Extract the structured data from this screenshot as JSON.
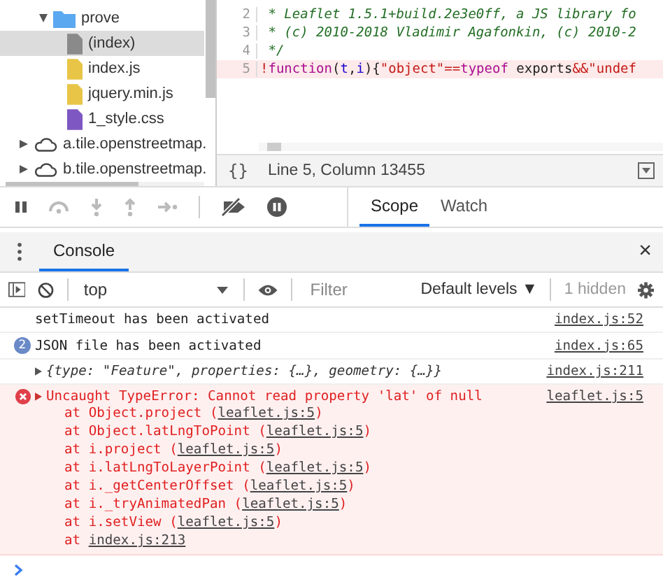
{
  "file_tree": [
    {
      "label": "prove",
      "kind": "folder",
      "expanded": true,
      "selected": false,
      "children": [
        {
          "label": "(index)",
          "kind": "document",
          "selected": true
        },
        {
          "label": "index.js",
          "kind": "script",
          "selected": false
        },
        {
          "label": "jquery.min.js",
          "kind": "script",
          "selected": false
        },
        {
          "label": "1_style.css",
          "kind": "stylesheet",
          "selected": false
        }
      ]
    },
    {
      "label": "a.tile.openstreetmap.",
      "kind": "domain",
      "expanded": false,
      "selected": false
    },
    {
      "label": "b.tile.openstreetmap.",
      "kind": "domain",
      "expanded": false,
      "selected": false
    }
  ],
  "editor": {
    "lines": [
      {
        "number": "2",
        "highlighted": false,
        "tokens": [
          {
            "kind": "comment",
            "text": " * Leaflet 1.5.1+build.2e3e0ff, a JS library fo"
          }
        ]
      },
      {
        "number": "3",
        "highlighted": false,
        "tokens": [
          {
            "kind": "comment",
            "text": " * (c) 2010-2018 Vladimir Agafonkin, (c) 2010-2"
          }
        ]
      },
      {
        "number": "4",
        "highlighted": false,
        "tokens": [
          {
            "kind": "comment",
            "text": " */"
          }
        ]
      },
      {
        "number": "5",
        "highlighted": true,
        "tokens": [
          {
            "kind": "operator",
            "text": "!"
          },
          {
            "kind": "keyword",
            "text": "function"
          },
          {
            "kind": "plain",
            "text": "("
          },
          {
            "kind": "variable",
            "text": "t"
          },
          {
            "kind": "plain",
            "text": ","
          },
          {
            "kind": "variable",
            "text": "i"
          },
          {
            "kind": "plain",
            "text": "){"
          },
          {
            "kind": "string",
            "text": "\"object\""
          },
          {
            "kind": "operator",
            "text": "=="
          },
          {
            "kind": "keyword",
            "text": "typeof"
          },
          {
            "kind": "plain",
            "text": " exports"
          },
          {
            "kind": "operator",
            "text": "&&"
          },
          {
            "kind": "string",
            "text": "\"undef"
          }
        ]
      }
    ],
    "format_button": "{}",
    "status": "Line 5, Column 13455"
  },
  "sidebar_tabs": [
    {
      "label": "Scope",
      "selected": true
    },
    {
      "label": "Watch",
      "selected": false
    }
  ],
  "drawer": {
    "tabs": [
      {
        "label": "Console",
        "selected": true
      }
    ],
    "close": "×"
  },
  "console_toolbar": {
    "context": "top",
    "filter_placeholder": "Filter",
    "levels": "Default levels ▼",
    "hidden": "1 hidden"
  },
  "messages": [
    {
      "kind": "log",
      "text": "setTimeout has been activated",
      "source": "index.js:52"
    },
    {
      "kind": "log",
      "count": "2",
      "text": "JSON file has been activated",
      "source": "index.js:65"
    },
    {
      "kind": "object",
      "expanded": false,
      "text": "{type: \"Feature\", properties: {…}, geometry: {…}}",
      "source": "index.js:211"
    },
    {
      "kind": "error",
      "expanded": false,
      "text": "Uncaught TypeError: Cannot read property 'lat' of null",
      "source": "leaflet.js:5",
      "frames": [
        {
          "prefix": "at Object.project (",
          "link": "leaflet.js:5",
          "suffix": ")"
        },
        {
          "prefix": "at Object.latLngToPoint (",
          "link": "leaflet.js:5",
          "suffix": ")"
        },
        {
          "prefix": "at i.project (",
          "link": "leaflet.js:5",
          "suffix": ")"
        },
        {
          "prefix": "at i.latLngToLayerPoint (",
          "link": "leaflet.js:5",
          "suffix": ")"
        },
        {
          "prefix": "at i._getCenterOffset (",
          "link": "leaflet.js:5",
          "suffix": ")"
        },
        {
          "prefix": "at i._tryAnimatedPan (",
          "link": "leaflet.js:5",
          "suffix": ")"
        },
        {
          "prefix": "at i.setView (",
          "link": "leaflet.js:5",
          "suffix": ")"
        },
        {
          "prefix": "at ",
          "link": "index.js:213"
        }
      ]
    }
  ]
}
